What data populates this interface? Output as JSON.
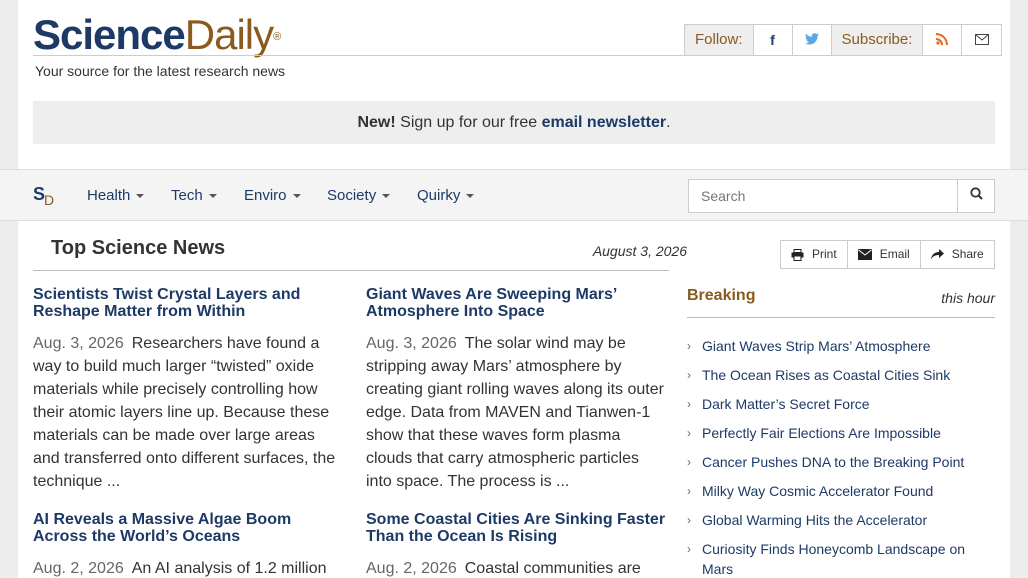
{
  "header": {
    "logo_science": "Science",
    "logo_daily": "Daily",
    "logo_reg": "®",
    "tagline": "Your source for the latest research news",
    "follow_label": "Follow:",
    "subscribe_label": "Subscribe:",
    "facebook_icon": "f",
    "twitter_icon": "🐦",
    "rss_icon": "))",
    "mail_icon": "✉"
  },
  "newsletter": {
    "new_label": "New!",
    "text": " Sign up for our free ",
    "link": "email newsletter",
    "end": "."
  },
  "nav": {
    "logo_s": "S",
    "logo_d": "D",
    "items": [
      "Health",
      "Tech",
      "Enviro",
      "Society",
      "Quirky"
    ],
    "search_placeholder": "Search"
  },
  "main": {
    "title": "Top Science News",
    "date": "August 3, 2026",
    "stories": [
      {
        "title": "Scientists Twist Crystal Layers and Reshape Matter from Within",
        "date": "Aug. 3, 2026",
        "summary": "Researchers have found a way to build much larger “twisted” oxide materials while precisely controlling how their atomic layers line up. Because these materials can be made over large areas and transferred onto different surfaces, the technique ..."
      },
      {
        "title": "Giant Waves Are Sweeping Mars’ Atmosphere Into Space",
        "date": "Aug. 3, 2026",
        "summary": "The solar wind may be stripping away Mars’ atmosphere by creating giant rolling waves along its outer edge. Data from MAVEN and Tianwen-1 show that these waves form plasma clouds that carry atmospheric particles into space. The process is ..."
      },
      {
        "title": "AI Reveals a Massive Algae Boom Across the World’s Oceans",
        "date": "Aug. 2, 2026",
        "summary": "An AI analysis of 1.2 million"
      },
      {
        "title": "Some Coastal Cities Are Sinking Faster Than the Ocean Is Rising",
        "date": "Aug. 2, 2026",
        "summary": "Coastal communities are"
      }
    ]
  },
  "sidebar": {
    "share_buttons": {
      "print": "Print",
      "email": "Email",
      "share": "Share"
    },
    "breaking_title": "Breaking",
    "breaking_time": "this hour",
    "breaking": [
      "Giant Waves Strip Mars’ Atmosphere",
      "The Ocean Rises as Coastal Cities Sink",
      "Dark Matter’s Secret Force",
      "Perfectly Fair Elections Are Impossible",
      "Cancer Pushes DNA to the Breaking Point",
      "Milky Way Cosmic Accelerator Found",
      "Global Warming Hits the Accelerator",
      "Curiosity Finds Honeycomb Landscape on Mars"
    ]
  },
  "colors": {
    "navy": "#1d3a66",
    "brown": "#8a5a1e"
  }
}
